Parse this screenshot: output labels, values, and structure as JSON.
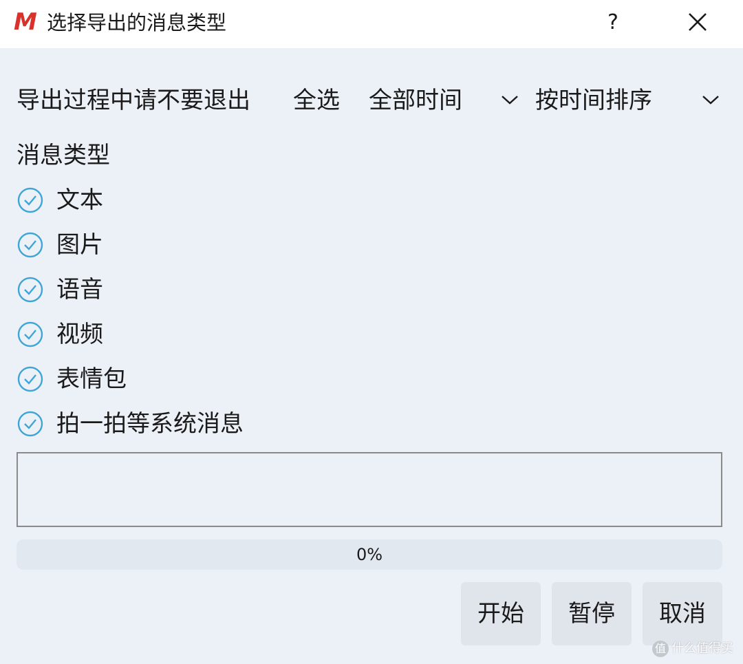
{
  "window": {
    "title": "选择导出的消息类型",
    "help_label": "?",
    "accent_color": "#d9322b"
  },
  "toolbar": {
    "notice": "导出过程中请不要退出",
    "select_all": "全选",
    "time_range": "全部时间",
    "sort_order": "按时间排序"
  },
  "message_types": {
    "label": "消息类型",
    "items": [
      {
        "label": "文本",
        "checked": true
      },
      {
        "label": "图片",
        "checked": true
      },
      {
        "label": "语音",
        "checked": true
      },
      {
        "label": "视频",
        "checked": true
      },
      {
        "label": "表情包",
        "checked": true
      },
      {
        "label": "拍一拍等系统消息",
        "checked": true
      }
    ],
    "check_color": "#3ea5d6"
  },
  "log": {
    "content": ""
  },
  "progress": {
    "value": 0,
    "text": "0%"
  },
  "buttons": {
    "start": "开始",
    "pause": "暂停",
    "cancel": "取消"
  },
  "watermark": {
    "text": "什么值得买",
    "icon_glyph": "值"
  }
}
